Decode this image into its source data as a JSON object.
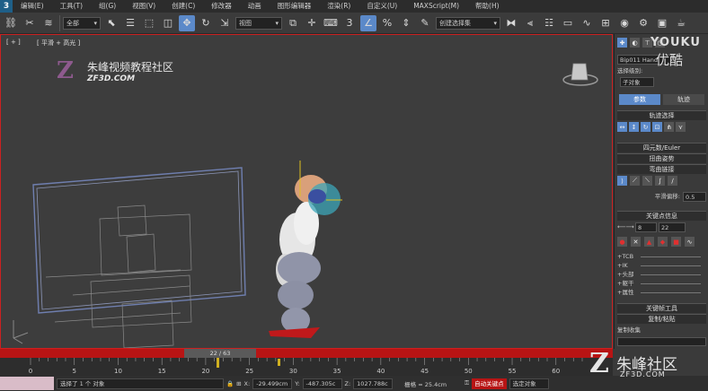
{
  "menubar": {
    "items": [
      "编辑(E)",
      "工具(T)",
      "组(G)",
      "视图(V)",
      "创建(C)",
      "修改器",
      "动画",
      "图形编辑器",
      "渲染(R)",
      "自定义(U)",
      "MAXScript(M)",
      "帮助(H)"
    ]
  },
  "toolbar": {
    "filter_select": "全部",
    "ref_coord_select": "视图",
    "named_selection": "创建选择集"
  },
  "viewport": {
    "label_bracket": "[ + ]",
    "label_shading": "[ 平滑 + 高光 ]",
    "watermark_title": "朱峰视频教程社区",
    "watermark_url": "ZF3D.COM",
    "watermark_logo": "Z"
  },
  "panel": {
    "object_name": "Bip011 Hand",
    "selection_level_label": "选择级别:",
    "sub_object": "子对象",
    "tab_params": "参数",
    "tab_track": "轨迹",
    "rollout_track_select": "轨迹选择",
    "rollout_quat_euler": "四元数/Euler",
    "rollout_twist": "扭曲姿势",
    "rollout_bend": "弯曲链接",
    "smooth_bias_label": "平滑偏移:",
    "smooth_bias_value": "0.5",
    "rollout_keyinfo": "关键点信息",
    "key_index": "8",
    "key_time": "22",
    "key_tcb": "+TCB",
    "key_ik": "+IK",
    "key_head": "+头部",
    "key_body": "+躯干",
    "key_props": "+属性",
    "rollout_keytools": "关键帧工具",
    "rollout_copypaste": "复制/粘贴",
    "copy_collection_label": "复制收集",
    "youku": "YOUKU",
    "youku_cn": "优酷"
  },
  "timeline": {
    "slider_label": "22 / 63",
    "ticks": [
      "0",
      "5",
      "10",
      "15",
      "20",
      "25",
      "30",
      "35",
      "40",
      "45",
      "50",
      "55",
      "60"
    ]
  },
  "statusbar": {
    "message": "选择了 1 个 对象",
    "x_label": "X:",
    "x_value": "-29.499cm",
    "y_label": "Y:",
    "y_value": "-487.305c",
    "z_label": "Z:",
    "z_value": "1027.788c",
    "grid_label": "栅格 = 25.4cm",
    "autokey": "自动关键点",
    "selected_filter": "选定对象"
  },
  "brand": {
    "logo": "Z",
    "name": "朱峰社区",
    "url": "ZF3D.COM"
  },
  "colors": {
    "accent_red": "#b81414",
    "active_blue": "#5b89c9"
  }
}
